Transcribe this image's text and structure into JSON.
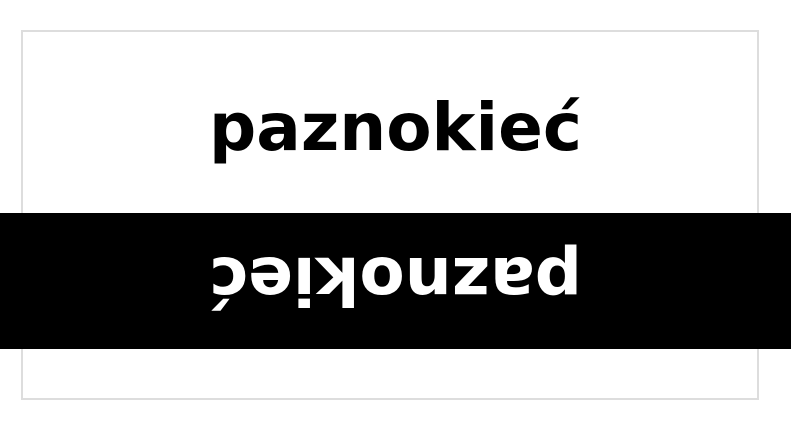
{
  "word_top": "paznokieć",
  "word_flipped": "paznokieć",
  "colors": {
    "background": "#ffffff",
    "frame_border": "#dddddd",
    "text_top": "#000000",
    "band": "#000000",
    "text_flipped": "#ffffff"
  }
}
